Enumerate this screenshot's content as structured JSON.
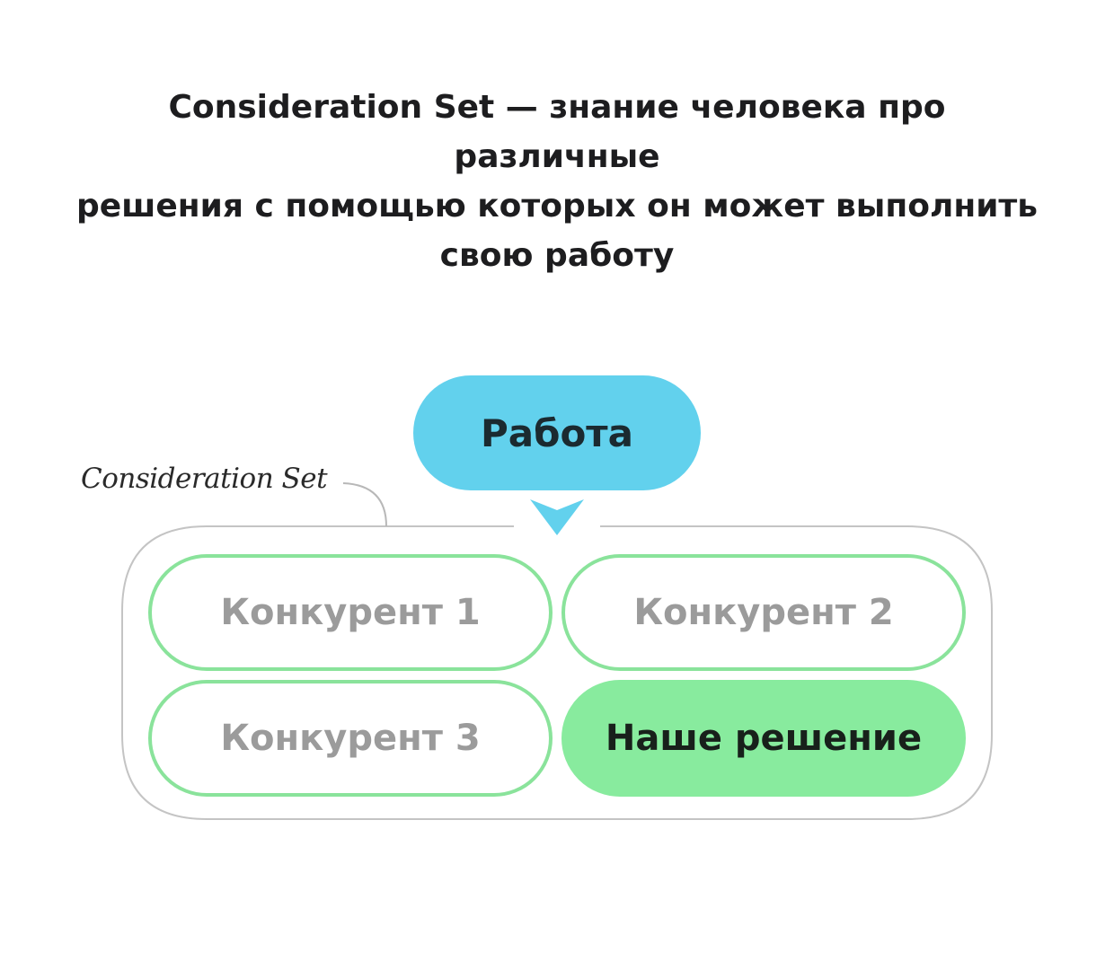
{
  "header": {
    "title": "Consideration Set — знание человека про различные\nрешения с помощью которых он может выполнить\nсвою работу"
  },
  "diagram": {
    "set_label": "Consideration Set",
    "job_label": "Работа",
    "options": [
      {
        "label": "Конкурент 1",
        "highlighted": false
      },
      {
        "label": "Конкурент 2",
        "highlighted": false
      },
      {
        "label": "Конкурент 3",
        "highlighted": false
      },
      {
        "label": "Наше решение",
        "highlighted": true
      }
    ],
    "colors": {
      "job_fill": "#62d1ed",
      "option_border": "#8ae39b",
      "ours_fill": "#88eb9e",
      "container_stroke": "#c4c4c4",
      "competitor_text": "#9b9b9b"
    }
  }
}
